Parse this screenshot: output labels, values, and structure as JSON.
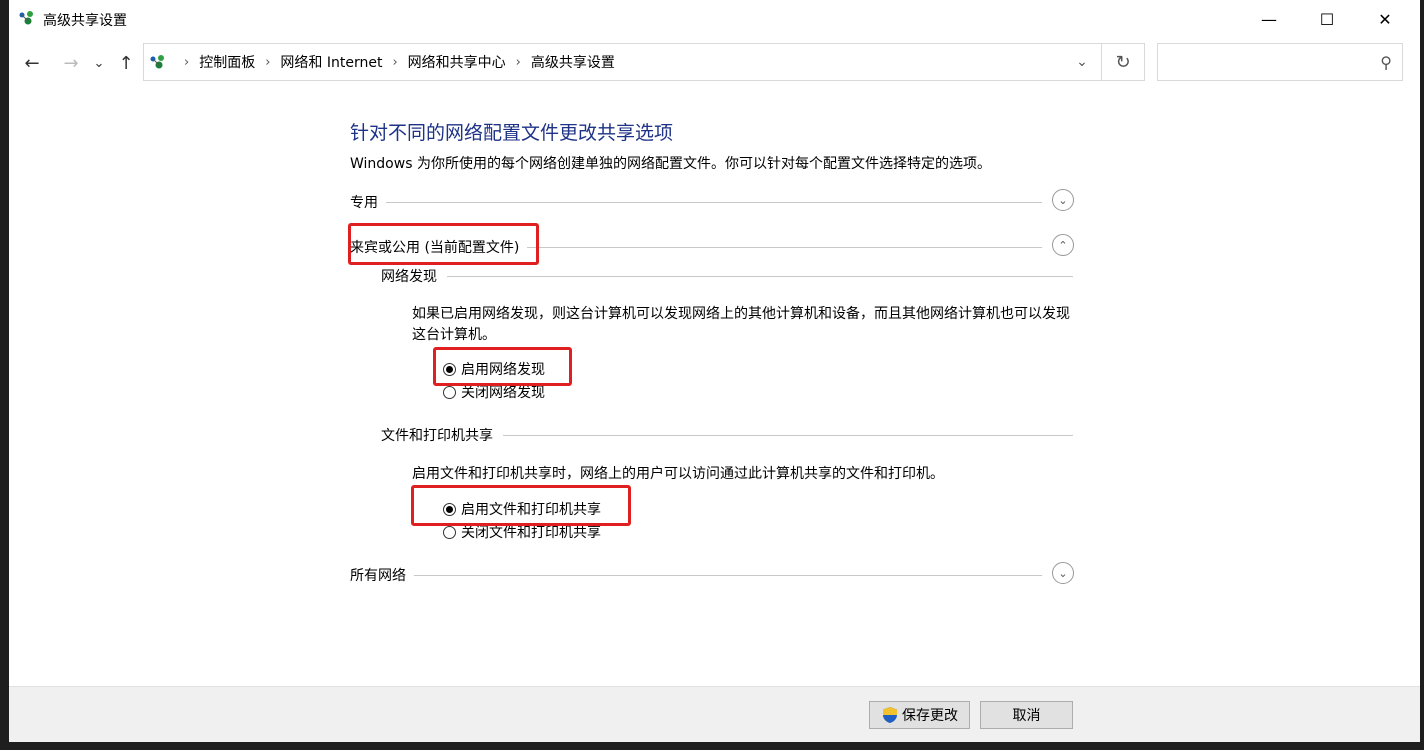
{
  "window": {
    "title": "高级共享设置",
    "minimize_glyph": "—",
    "maximize_glyph": "☐",
    "close_glyph": "✕"
  },
  "nav": {
    "back_glyph": "←",
    "forward_glyph": "→",
    "recent_glyph": "⌄",
    "up_glyph": "↑",
    "breadcrumbs": [
      "控制面板",
      "网络和 Internet",
      "网络和共享中心",
      "高级共享设置"
    ],
    "separator": "›",
    "dropdown_glyph": "⌄",
    "refresh_glyph": "↻",
    "search_placeholder": "",
    "search_glyph": "⚲"
  },
  "main": {
    "heading": "针对不同的网络配置文件更改共享选项",
    "subtitle": "Windows 为你所使用的每个网络创建单独的网络配置文件。你可以针对每个配置文件选择特定的选项。",
    "profiles": [
      {
        "label": "专用",
        "expanded": false,
        "chevron": "⌄"
      },
      {
        "label": "来宾或公用 (当前配置文件)",
        "expanded": true,
        "chevron": "⌃"
      },
      {
        "label": "所有网络",
        "expanded": false,
        "chevron": "⌄"
      }
    ],
    "network_discovery": {
      "title": "网络发现",
      "description": "如果已启用网络发现，则这台计算机可以发现网络上的其他计算机和设备，而且其他网络计算机也可以发现这台计算机。",
      "option_on": "启用网络发现",
      "option_off": "关闭网络发现",
      "selected": "on"
    },
    "file_printer_sharing": {
      "title": "文件和打印机共享",
      "description": "启用文件和打印机共享时，网络上的用户可以访问通过此计算机共享的文件和打印机。",
      "option_on": "启用文件和打印机共享",
      "option_off": "关闭文件和打印机共享",
      "selected": "on"
    }
  },
  "footer": {
    "save_label": "保存更改",
    "cancel_label": "取消"
  },
  "colors": {
    "heading": "#1e3287",
    "highlight": "#e02020"
  }
}
